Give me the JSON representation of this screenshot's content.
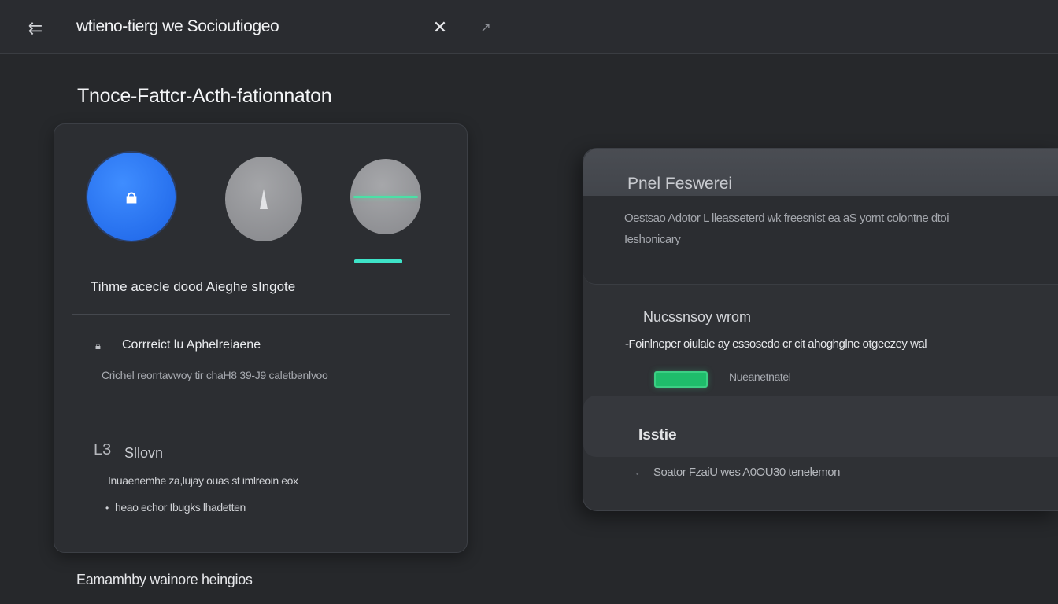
{
  "topbar": {
    "back_icon": "back-arrow-icon",
    "back_glyph": "⇇",
    "title": "wtieno-tierg we Socioutiogeo",
    "close_glyph": "✕",
    "arrow_glyph": "↗"
  },
  "page": {
    "title": "Tnoce-Fattcr-Acth-fationnaton",
    "footer_link": "Eamamhby wainore heingios"
  },
  "left_card": {
    "methods": [
      {
        "icon": "lock-icon",
        "glyph": "🔒",
        "color": "#2d74f5",
        "selected": true
      },
      {
        "icon": "pen-icon",
        "color": "#96979b"
      },
      {
        "icon": "line-icon",
        "color": "#98999d"
      }
    ],
    "active_color": "#3ee3c8",
    "method_caption": "Tihme acecle dood Aieghe sIngote",
    "item_icon_glyph": "🔒",
    "item_title": "Corrreict lu Aphelreiaene",
    "item_description": "Crichel reorrtavwoy tir chaH8 39-J9 caletbenlvoo",
    "sms_icon_glyph": "L3",
    "sms_title": "Sllovn",
    "sms_description": "Inuaenemhe za,lujay ouas st imlreoin eox",
    "sms_bullet": "•",
    "sms_note": "heao echor Ibugks lhadetten"
  },
  "right_panel": {
    "header_title": "Pnel Feswerei",
    "description_line_1": "Oestsao Adotor L lleasseterd wk freesnist ea aS yornt colontne dtoi",
    "description_line_2": "Ieshonicary",
    "section_2_title": "Nucssnsoy wrom",
    "section_2_description": "-Foinlneper oiulale ay essosedo cr cit ahoghglne otgeezey wal",
    "status_color": "#1fbd6b",
    "status_label": "Nueanetnatel",
    "section_3_title": "Isstie",
    "section_3_bullet": "•",
    "section_3_description": "Soator FzaiU wes A0OU30 tenelemon"
  }
}
